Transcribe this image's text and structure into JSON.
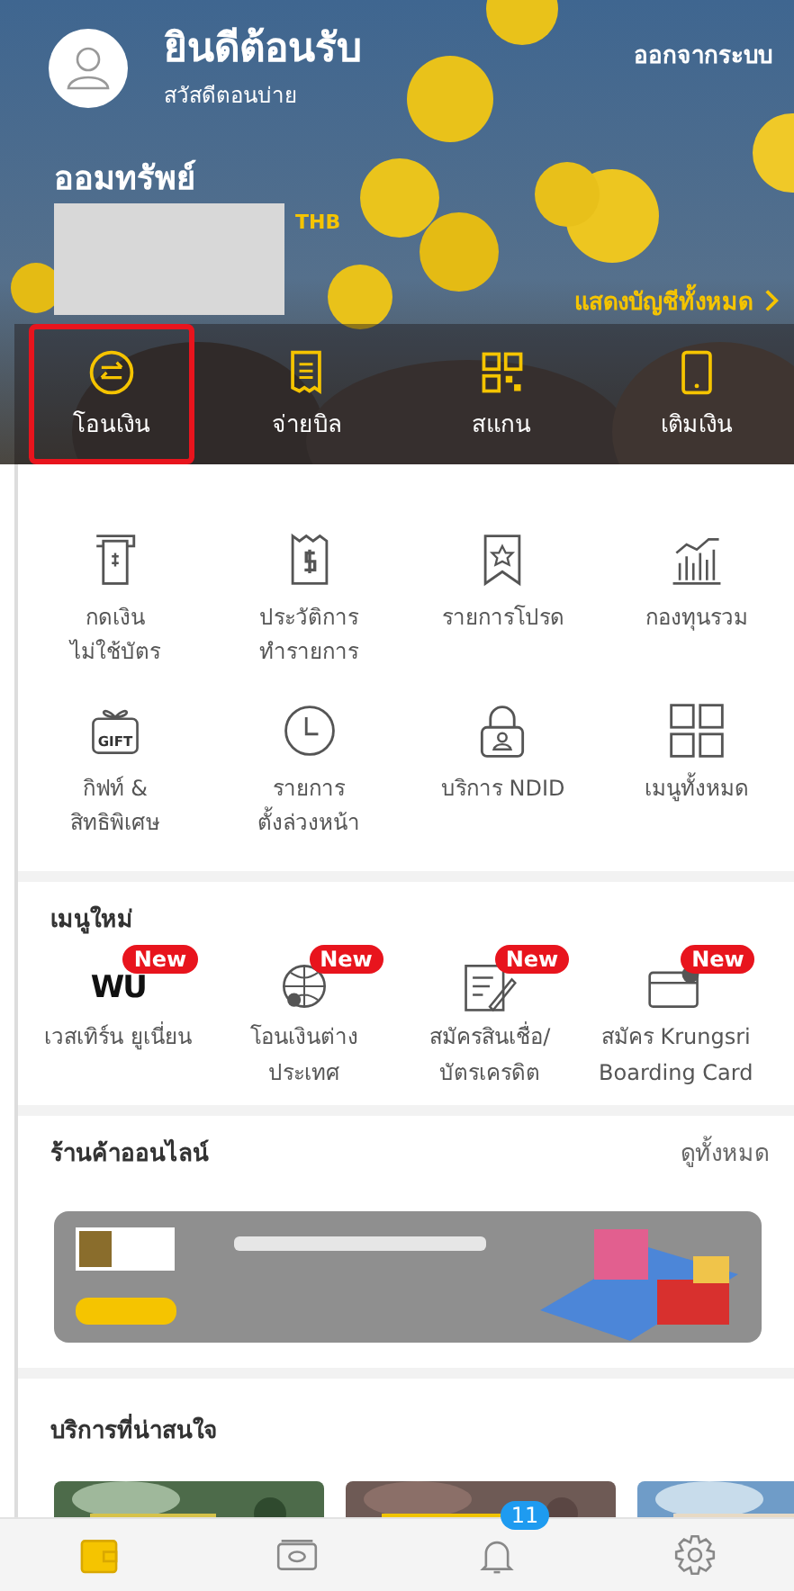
{
  "header": {
    "greeting": "ยินดีต้อนรับ",
    "subtitle": "สวัสดีตอนบ่าย",
    "logout": "ออกจากระบบ",
    "account_name": "ออมทรัพย์",
    "currency": "THB",
    "show_all": "แสดงบัญชีทั้งหมด"
  },
  "shortcuts": [
    {
      "label": "โอนเงิน",
      "selected": true
    },
    {
      "label": "จ่ายบิล",
      "selected": false
    },
    {
      "label": "สแกน",
      "selected": false
    },
    {
      "label": "เติมเงิน",
      "selected": false
    }
  ],
  "menu": [
    {
      "label": "กดเงิน\nไม่ใช้บัตร"
    },
    {
      "label": "ประวัติการ\nทำรายการ"
    },
    {
      "label": "รายการโปรด"
    },
    {
      "label": "กองทุนรวม"
    },
    {
      "label": "กิฟท์ &\nสิทธิพิเศษ",
      "icon_text": "GIFT"
    },
    {
      "label": "รายการ\nตั้งล่วงหน้า"
    },
    {
      "label": "บริการ NDID"
    },
    {
      "label": "เมนูทั้งหมด"
    }
  ],
  "new_menu": {
    "title": "เมนูใหม่",
    "items": [
      {
        "label": "เวสเทิร์น ยูเนี่ยน",
        "badge": "New",
        "logo_text": "WU"
      },
      {
        "label": "โอนเงินต่าง\nประเทศ",
        "badge": "New"
      },
      {
        "label": "สมัครสินเชื่อ/\nบัตรเครดิต",
        "badge": "New"
      },
      {
        "label": "สมัคร Krungsri\nBoarding Card",
        "badge": "New"
      }
    ]
  },
  "online_shop": {
    "title": "ร้านค้าออนไลน์",
    "view_all": "ดูทั้งหมด"
  },
  "services": {
    "title": "บริการที่น่าสนใจ"
  },
  "bottom_nav": [
    {
      "selected": true
    },
    {
      "selected": false
    },
    {
      "selected": false,
      "badge": "11"
    },
    {
      "selected": false
    }
  ]
}
